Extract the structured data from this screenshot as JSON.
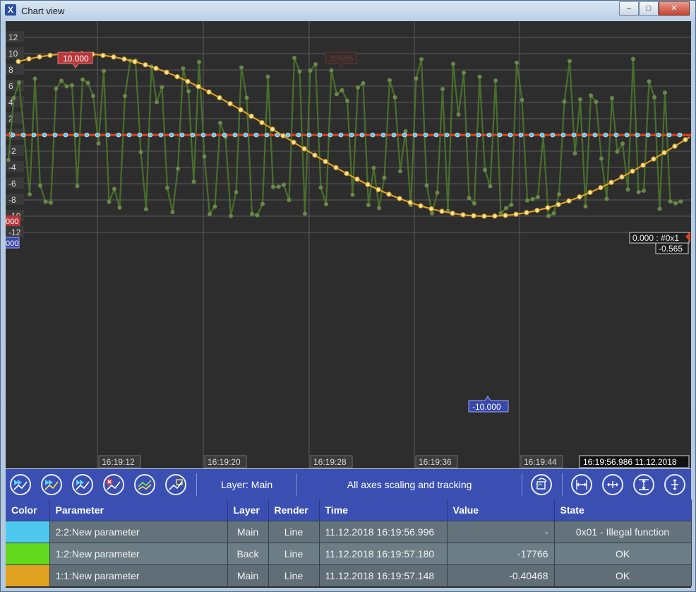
{
  "window": {
    "title": "Chart view",
    "controls": [
      "–",
      "□",
      "✕"
    ]
  },
  "colors": {
    "sine": "#e8a51c",
    "noise": "#6ab53a",
    "flat": "#e04220",
    "points_cyan": "#59c6ee",
    "toolbar": "#3b4fb3"
  },
  "chart": {
    "y_ticks": [
      "12",
      "10",
      "8",
      "6",
      "4",
      "2",
      "0",
      "-2",
      "-4",
      "-6",
      "-8",
      "-10",
      "-12"
    ],
    "x_ticks": [
      "16:19:12",
      "16:19:20",
      "16:19:28",
      "16:19:36",
      "16:19:44"
    ],
    "timestamp": "16:19:56.986 11.12.2018",
    "max_label": "10.000",
    "min_label": "-10.000",
    "faint_label": "32695",
    "left_marker_top": "000",
    "left_marker_bottom": "000",
    "cursor_label_1": "0.000 : #0x1",
    "cursor_label_2": "-0.565"
  },
  "chart_data": {
    "type": "line",
    "ylim": [
      -12,
      12
    ],
    "x": [
      "16:19:12",
      "16:19:20",
      "16:19:28",
      "16:19:36",
      "16:19:44"
    ],
    "grid": true,
    "series": [
      {
        "name": "1:1:New parameter",
        "color": "#e8a51c",
        "shape": "sine",
        "max": 10.0,
        "min": -10.0,
        "last": -0.565
      },
      {
        "name": "1:2:New parameter",
        "color": "#6ab53a",
        "shape": "random",
        "last": -17766
      },
      {
        "name": "2:2:New parameter",
        "color": "#e04220",
        "shape": "flat",
        "value": 0
      }
    ]
  },
  "toolbar": {
    "layer_label": "Layer: Main",
    "mode_label": "All axes scaling and tracking",
    "left_buttons": [
      "play-all-icon",
      "play-layer-icon",
      "play-main-icon",
      "remove-chart-icon",
      "chart-green-icon",
      "chart-yellow-icon"
    ],
    "right_buttons": [
      "switch-layer-icon",
      "fit-x-icon",
      "scale-x-icon",
      "fit-y-icon",
      "scale-y-icon"
    ]
  },
  "table": {
    "headers": [
      "Color",
      "Parameter",
      "Layer",
      "Render",
      "Time",
      "Value",
      "State"
    ],
    "rows": [
      {
        "color": "#4fc8f0",
        "parameter": "2:2:New parameter",
        "layer": "Main",
        "render": "Line",
        "time": "11.12.2018 16:19:56.996",
        "value": "-",
        "state": "0x01 - Illegal function"
      },
      {
        "color": "#62d81e",
        "parameter": "1:2:New parameter",
        "layer": "Back",
        "render": "Line",
        "time": "11.12.2018 16:19:57.180",
        "value": "-17766",
        "state": "OK"
      },
      {
        "color": "#e0a020",
        "parameter": "1:1:New parameter",
        "layer": "Main",
        "render": "Line",
        "time": "11.12.2018 16:19:57.148",
        "value": "-0.40468",
        "state": "OK"
      }
    ]
  }
}
